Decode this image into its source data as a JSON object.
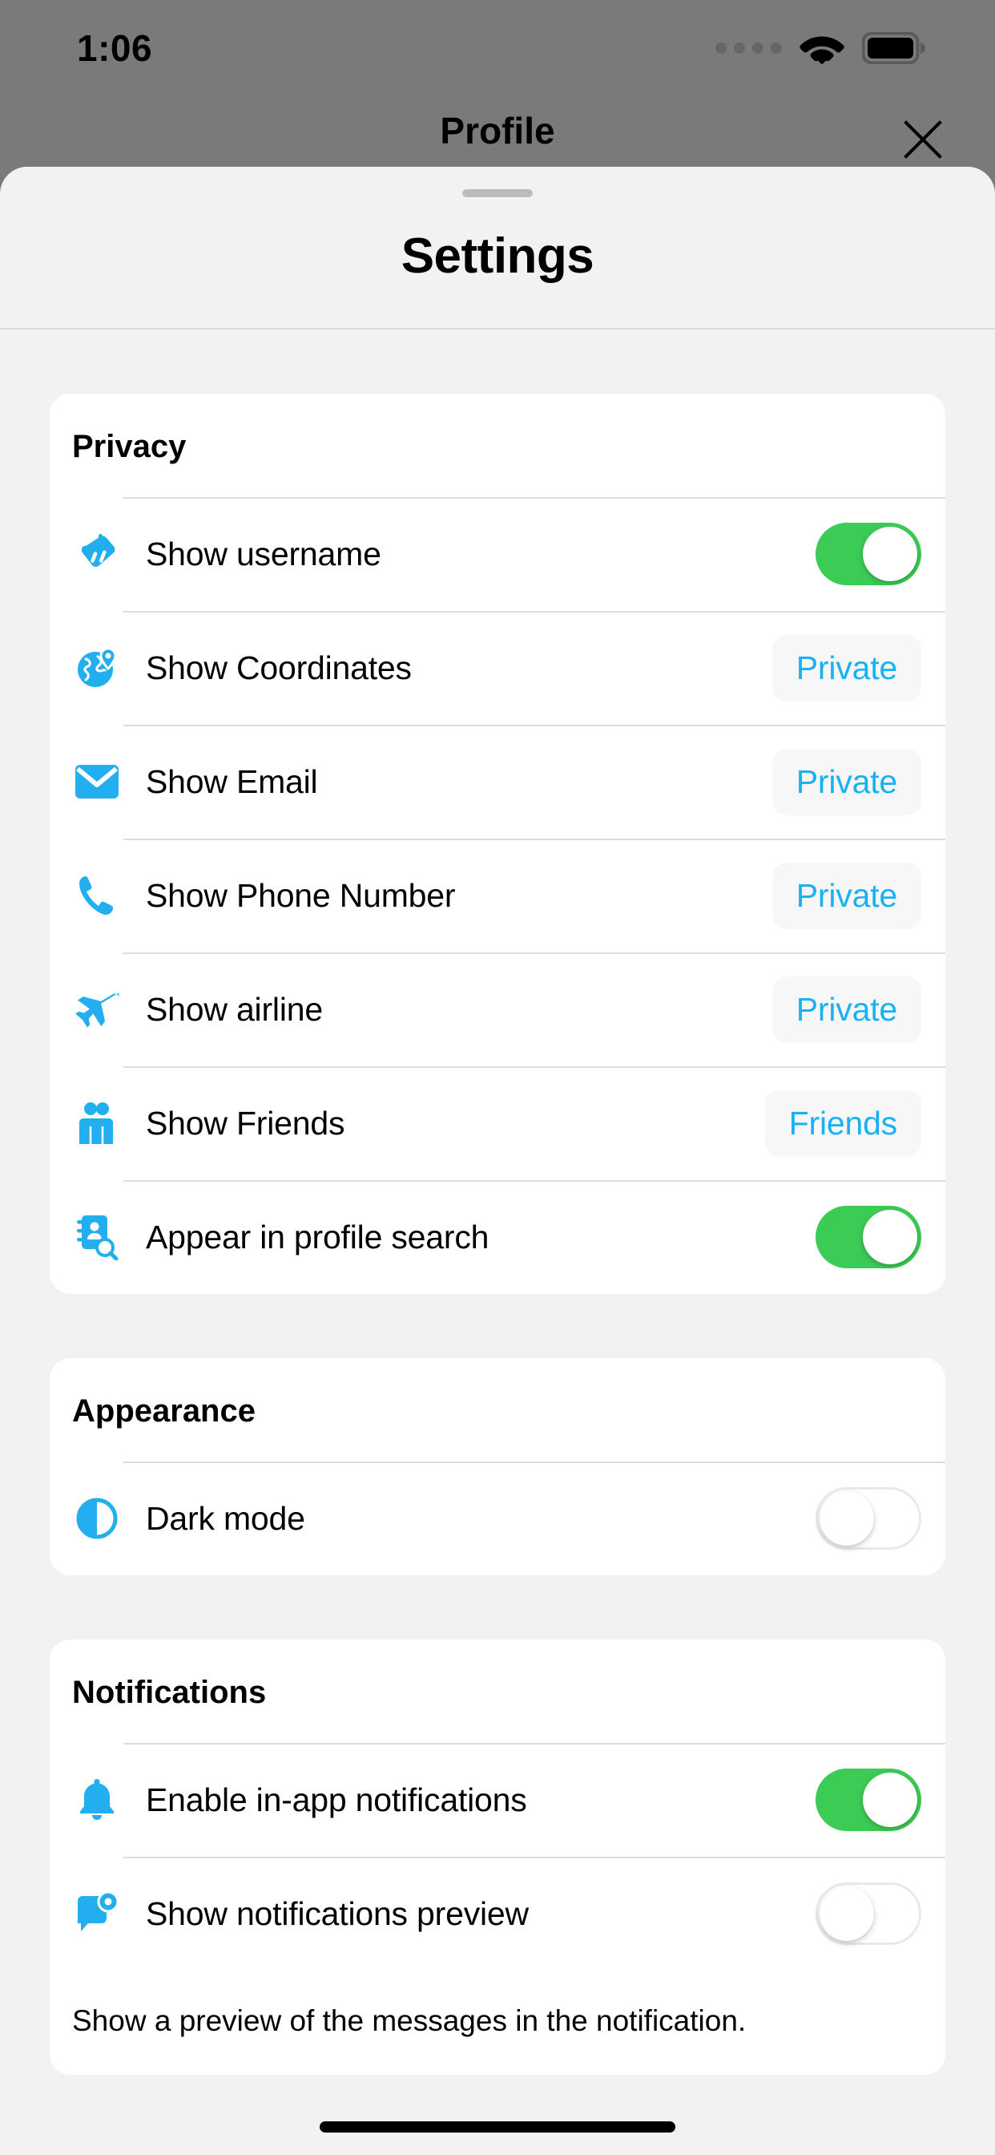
{
  "status_bar": {
    "time": "1:06",
    "signal_icon": "signal-dots-icon",
    "wifi_icon": "wifi-icon",
    "battery_icon": "battery-full-icon"
  },
  "under_screen": {
    "nav_title": "Profile",
    "close_icon": "close-icon"
  },
  "sheet": {
    "grabber": "sheet-grabber",
    "title": "Settings"
  },
  "colors": {
    "accent_blue": "#17b2f5",
    "icon_blue": "#22aeef",
    "toggle_on_green": "#3ccb55",
    "badge_bg": "#f7f7f7",
    "card_bg": "#ffffff",
    "page_bg": "#f2f2f2",
    "dim_backdrop": "#7a7a7a"
  },
  "sections": [
    {
      "title": "Privacy",
      "rows": [
        {
          "icon": "tag-icon",
          "label": "Show username",
          "control": "toggle",
          "value": "on"
        },
        {
          "icon": "globe-location-icon",
          "label": "Show Coordinates",
          "control": "badge",
          "value": "Private"
        },
        {
          "icon": "envelope-icon",
          "label": "Show Email",
          "control": "badge",
          "value": "Private"
        },
        {
          "icon": "phone-icon",
          "label": "Show Phone Number",
          "control": "badge",
          "value": "Private"
        },
        {
          "icon": "airplane-icon",
          "label": "Show airline",
          "control": "badge",
          "value": "Private"
        },
        {
          "icon": "people-icon",
          "label": "Show Friends",
          "control": "badge",
          "value": "Friends"
        },
        {
          "icon": "contact-search-icon",
          "label": "Appear in profile search",
          "control": "toggle",
          "value": "on"
        }
      ],
      "footer": ""
    },
    {
      "title": "Appearance",
      "rows": [
        {
          "icon": "half-circle-icon",
          "label": "Dark mode",
          "control": "toggle",
          "value": "off"
        }
      ],
      "footer": ""
    },
    {
      "title": "Notifications",
      "rows": [
        {
          "icon": "bell-icon",
          "label": "Enable in-app notifications",
          "control": "toggle",
          "value": "on"
        },
        {
          "icon": "message-preview-icon",
          "label": "Show notifications preview",
          "control": "toggle",
          "value": "off"
        }
      ],
      "footer": "Show a preview of the messages in the notification."
    }
  ],
  "home_indicator": "home-indicator"
}
